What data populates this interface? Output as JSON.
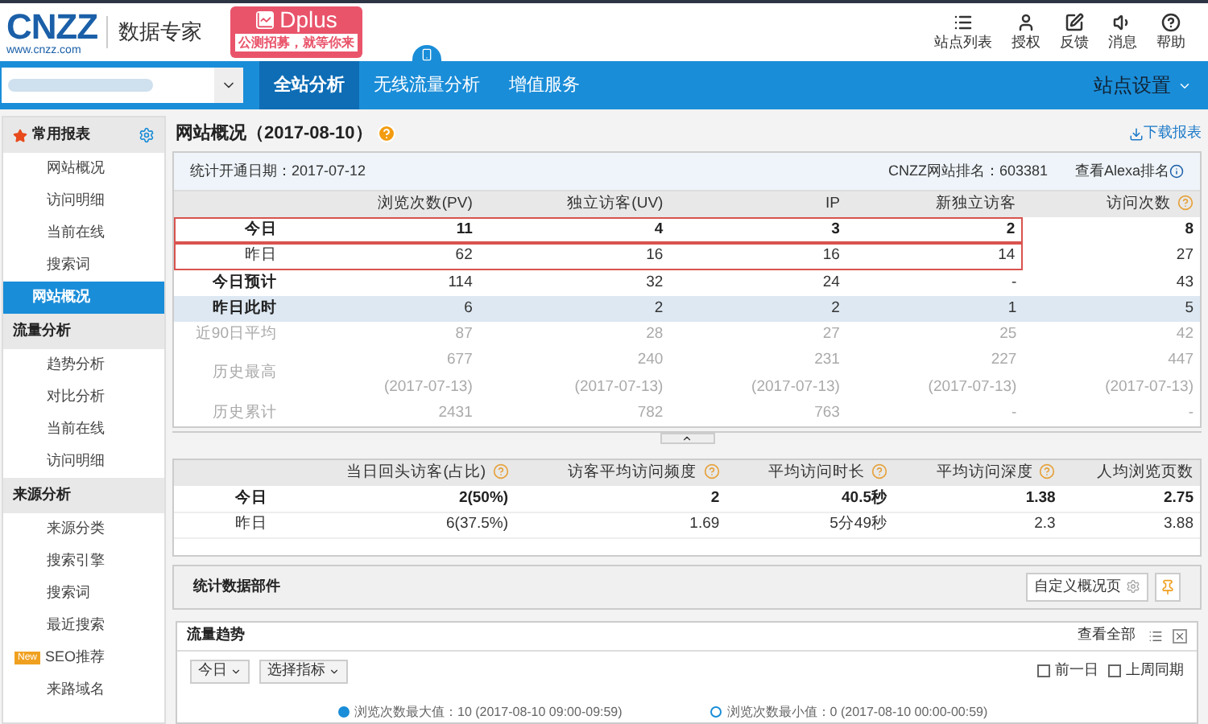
{
  "header": {
    "logo": "CNZZ",
    "logo_url": "www.cnzz.com",
    "product": "数据专家",
    "promo": {
      "title": "Dplus",
      "subtitle": "公测招募，就等你来"
    },
    "tools": [
      {
        "kind": "list",
        "label": "站点列表"
      },
      {
        "kind": "user",
        "label": "授权"
      },
      {
        "kind": "edit",
        "label": "反馈"
      },
      {
        "kind": "sound",
        "label": "消息"
      },
      {
        "kind": "help",
        "label": "帮助"
      }
    ]
  },
  "nav": {
    "tabs": [
      {
        "label": "全站分析",
        "selected": true,
        "mobile": false
      },
      {
        "label": "无线流量分析",
        "selected": false,
        "mobile": true
      },
      {
        "label": "增值服务",
        "selected": false,
        "mobile": false
      }
    ],
    "settings": "站点设置"
  },
  "sidebar": [
    {
      "title": "常用报表",
      "favorites": true,
      "items": [
        {
          "label": "网站概况",
          "selected": false
        },
        {
          "label": "访问明细",
          "selected": false
        },
        {
          "label": "当前在线",
          "selected": false
        },
        {
          "label": "搜索词",
          "selected": false
        },
        {
          "label": "网站概况",
          "selected": true
        }
      ]
    },
    {
      "title": "流量分析",
      "favorites": false,
      "items": [
        {
          "label": "趋势分析",
          "selected": false
        },
        {
          "label": "对比分析",
          "selected": false
        },
        {
          "label": "当前在线",
          "selected": false
        },
        {
          "label": "访问明细",
          "selected": false
        }
      ]
    },
    {
      "title": "来源分析",
      "favorites": false,
      "items": [
        {
          "label": "来源分类",
          "selected": false
        },
        {
          "label": "搜索引擎",
          "selected": false
        },
        {
          "label": "搜索词",
          "selected": false
        },
        {
          "label": "最近搜索",
          "selected": false
        },
        {
          "label": "SEO推荐",
          "selected": false,
          "badge": "New"
        },
        {
          "label": "来路域名",
          "selected": false
        }
      ]
    }
  ],
  "page": {
    "title": "网站概况（2017-08-10）",
    "download": "下载报表"
  },
  "summary": {
    "open_date": "统计开通日期：2017-07-12",
    "rank": "CNZZ网站排名：603381",
    "alexa": "查看Alexa排名",
    "columns": [
      {
        "label": "浏览次数(PV)",
        "help": false
      },
      {
        "label": "独立访客(UV)",
        "help": false
      },
      {
        "label": "IP",
        "help": false
      },
      {
        "label": "新独立访客",
        "help": false
      },
      {
        "label": "访问次数",
        "help": true
      }
    ],
    "rows": [
      {
        "label": "今日",
        "outlined": true,
        "shaded": false,
        "kind": "bold",
        "cells": [
          "11",
          "4",
          "3",
          "2",
          "8"
        ]
      },
      {
        "label": "昨日",
        "outlined": true,
        "shaded": false,
        "kind": "plain",
        "cells": [
          "62",
          "16",
          "16",
          "14",
          "27"
        ]
      },
      {
        "label": "今日预计",
        "outlined": false,
        "shaded": false,
        "kind": "heading",
        "cells": [
          "114",
          "32",
          "24",
          "-",
          "43"
        ]
      },
      {
        "label": "昨日此时",
        "outlined": false,
        "shaded": true,
        "kind": "heading",
        "cells": [
          "6",
          "2",
          "2",
          "1",
          "5"
        ]
      },
      {
        "label": "近90日平均",
        "outlined": false,
        "shaded": false,
        "kind": "muted",
        "cells": [
          "87",
          "28",
          "27",
          "25",
          "42"
        ]
      },
      {
        "label": "历史最高",
        "outlined": false,
        "shaded": false,
        "kind": "muted",
        "cells": [
          "677",
          "240",
          "231",
          "227",
          "447"
        ],
        "dates": [
          "(2017-07-13)",
          "(2017-07-13)",
          "(2017-07-13)",
          "(2017-07-13)",
          "(2017-07-13)"
        ]
      },
      {
        "label": "历史累计",
        "outlined": false,
        "shaded": false,
        "kind": "muted",
        "cells": [
          "2431",
          "782",
          "763",
          "-",
          "-"
        ]
      }
    ]
  },
  "quality": {
    "columns": [
      {
        "label": "当日回头访客(占比)",
        "help": true
      },
      {
        "label": "访客平均访问频度",
        "help": true
      },
      {
        "label": "平均访问时长",
        "help": true
      },
      {
        "label": "平均访问深度",
        "help": true
      },
      {
        "label": "人均浏览页数",
        "help": false
      }
    ],
    "rows": [
      {
        "label": "今日",
        "kind": "bold",
        "cells": [
          "2(50%)",
          "2",
          "40.5秒",
          "1.38",
          "2.75"
        ]
      },
      {
        "label": "昨日",
        "kind": "plain",
        "cells": [
          "6(37.5%)",
          "1.69",
          "5分49秒",
          "2.3",
          "3.88"
        ]
      }
    ]
  },
  "widgets": {
    "title": "统计数据部件",
    "customize": "自定义概况页"
  },
  "trend": {
    "title": "流量趋势",
    "view_all": "查看全部",
    "period": "今日",
    "metric": "选择指标",
    "compare": [
      {
        "label": "前一日",
        "checked": false
      },
      {
        "label": "上周同期",
        "checked": false
      }
    ],
    "legend": [
      {
        "kind": "max",
        "text": "浏览次数最大值：10 (2017-08-10 09:00-09:59)"
      },
      {
        "kind": "min",
        "text": "浏览次数最小值：0 (2017-08-10 00:00-00:59)"
      }
    ]
  }
}
